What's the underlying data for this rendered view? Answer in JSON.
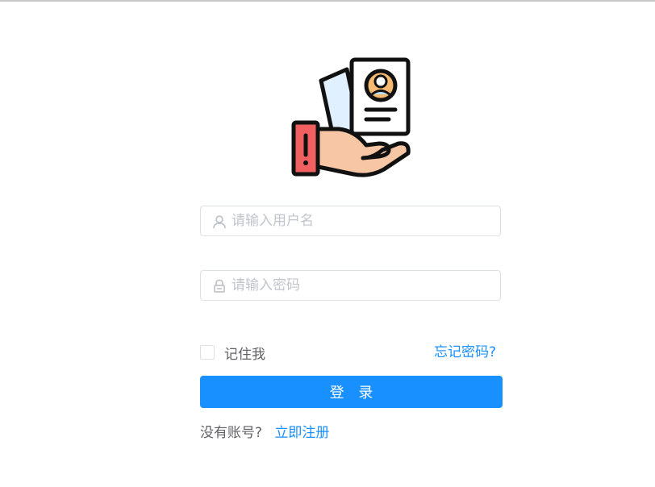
{
  "login": {
    "username_placeholder": "请输入用户名",
    "username_value": "",
    "password_placeholder": "请输入密码",
    "password_value": "",
    "remember_label": "记住我",
    "forgot_label": "忘记密码?",
    "submit_label": "登 录",
    "no_account_text": "没有账号?",
    "register_label": "立即注册"
  },
  "icons": {
    "logo": "hand-holding-id-card-icon",
    "username": "user-icon",
    "password": "lock-icon"
  },
  "colors": {
    "primary": "#1890ff",
    "border": "#dcdfe6",
    "placeholder": "#c0c4cc",
    "text": "#606266"
  }
}
